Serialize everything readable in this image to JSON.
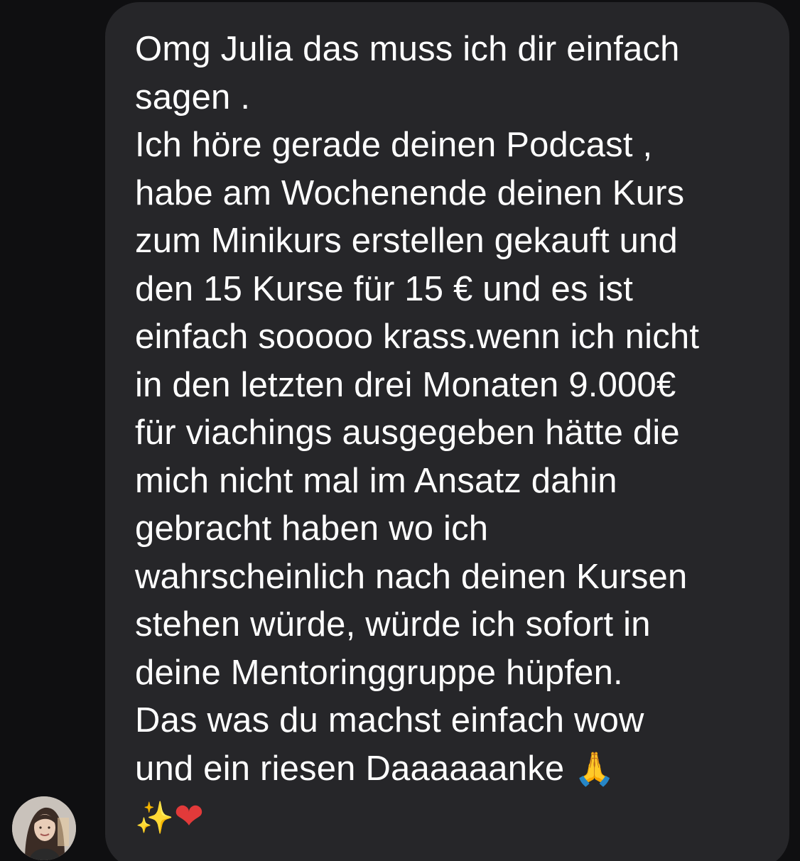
{
  "message": {
    "lines": [
      "Omg Julia das muss ich dir einfach",
      "sagen .",
      "Ich höre gerade deinen Podcast ,",
      "habe am Wochenende deinen Kurs",
      "zum Minikurs erstellen gekauft und",
      "den 15 Kurse für 15 € und es ist",
      "einfach sooooo krass.wenn ich nicht",
      "in den letzten drei Monaten 9.000€",
      "für viachings ausgegeben hätte die",
      "mich nicht mal im Ansatz dahin",
      "gebracht haben wo ich",
      "wahrscheinlich nach deinen Kursen",
      "stehen würde, würde ich sofort in",
      "deine Mentoringgruppe hüpfen.",
      "Das was du machst einfach wow",
      "und ein riesen Daaaaaanke"
    ],
    "emoji_pray": "🙏",
    "emoji_sparkles": "✨",
    "emoji_heart": "❤"
  },
  "sender": {
    "avatar_icon": "profile-photo"
  },
  "colors": {
    "background": "#0f0f11",
    "bubble": "#262629",
    "text": "#ffffff"
  }
}
